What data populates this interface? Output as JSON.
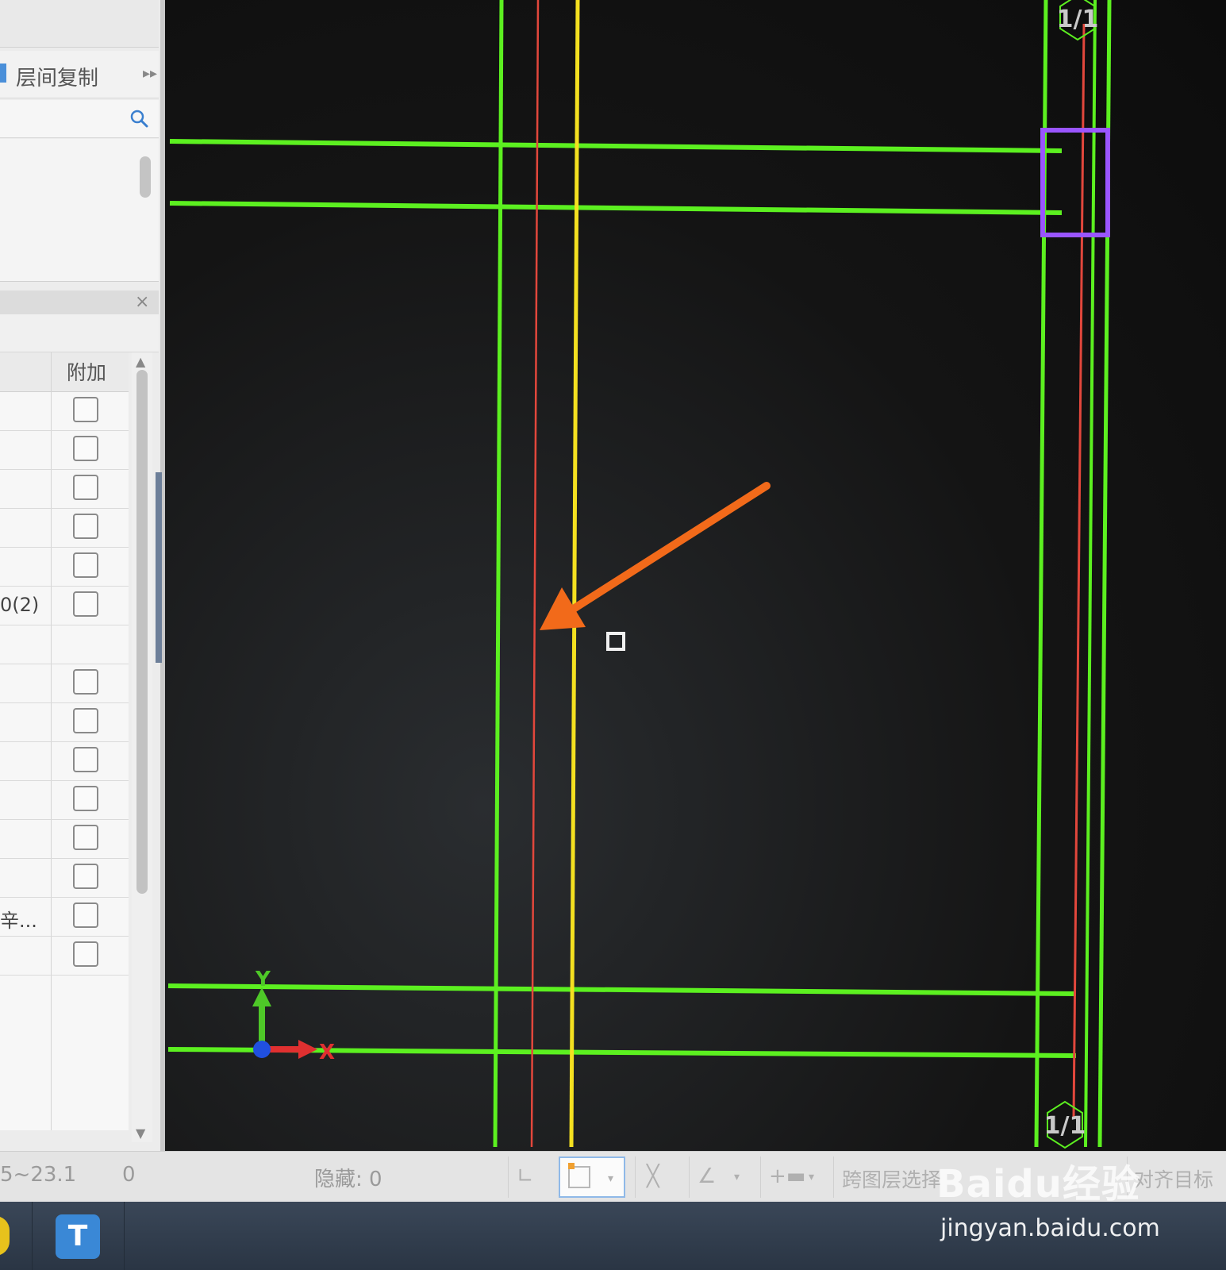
{
  "left_panel": {
    "copy_label": "层间复制",
    "table_header_right": "附加",
    "row_texts": [
      "",
      "",
      "",
      "",
      "",
      "0(2)",
      "",
      "",
      "",
      "",
      "",
      "",
      "",
      "辛...",
      ""
    ],
    "row_has_checkbox": [
      true,
      true,
      true,
      true,
      true,
      true,
      false,
      true,
      true,
      true,
      true,
      true,
      true,
      true,
      true
    ]
  },
  "canvas": {
    "axis_top_label": "1/1",
    "axis_bottom_label": "1/1",
    "ucs_y": "Y",
    "ucs_x": "X",
    "colors": {
      "wall_green": "#5cf020",
      "axis_red": "#e2473c",
      "edge_yellow": "#f4e020",
      "column_purple": "#9a55ff",
      "arrow_orange": "#f26a1a"
    }
  },
  "statusbar": {
    "range": "5~23.1",
    "zero": "0",
    "hidden": "隐藏: 0",
    "cross_layer": "跨图层选择",
    "align_target": "对齐目标"
  },
  "taskbar": {
    "app_letter": "T"
  },
  "watermark": {
    "logo": "Baidu经验",
    "url": "jingyan.baidu.com"
  }
}
